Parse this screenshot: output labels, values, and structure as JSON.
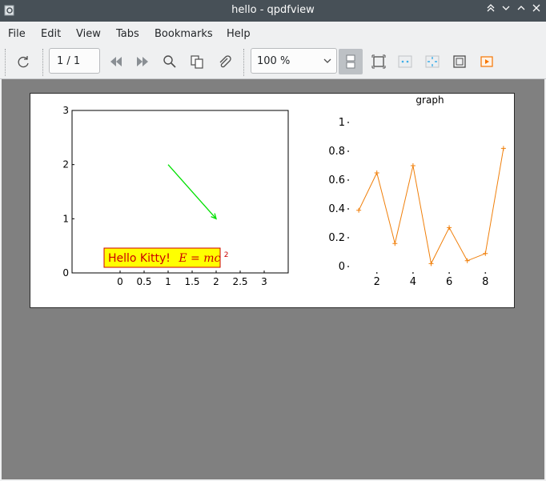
{
  "window": {
    "title": "hello - qpdfview",
    "buttons": [
      "keep-above",
      "minimize",
      "maximize",
      "close"
    ]
  },
  "menu": {
    "items": [
      "File",
      "Edit",
      "View",
      "Tabs",
      "Bookmarks",
      "Help"
    ]
  },
  "toolbar": {
    "page_indicator": "1 / 1",
    "zoom_value": "100 %",
    "icons": [
      "refresh-icon",
      "previous-page-icon",
      "next-page-icon",
      "search-icon",
      "copy-to-clipboard-icon",
      "attachment-icon",
      "continuous-mode-icon",
      "fit-to-page-icon",
      "two-pages-icon",
      "presentation-icon",
      "fullscreen-icon",
      "slideshow-icon"
    ],
    "accent_color": "#f67400"
  },
  "document": {
    "left_plot": {
      "label_text": "Hello Kitty!",
      "label_formula": "E = mc",
      "label_formula_exponent": "2",
      "label_text_color": "#cc0000",
      "label_fill_color": "#ffff00",
      "arrow_color": "#00e000"
    },
    "right_plot": {
      "title": "graph",
      "line_color": "#f07f0a"
    }
  },
  "chart_data": [
    {
      "type": "line",
      "title": "",
      "xlabel": "",
      "ylabel": "",
      "xlim": [
        -1,
        3.5
      ],
      "ylim": [
        0,
        3
      ],
      "x_ticks": [
        "0",
        "0.5",
        "1",
        "1.5",
        "2",
        "2.5",
        "3"
      ],
      "y_ticks": [
        "0",
        "1",
        "2",
        "3"
      ],
      "series": [
        {
          "x": [
            1,
            2
          ],
          "y": [
            2,
            1
          ],
          "style": "arrow"
        }
      ],
      "annotation": {
        "text": "Hello Kitty! E = mc^2",
        "x": 1.25,
        "y": 0.27
      }
    },
    {
      "type": "line",
      "title": "graph",
      "xlabel": "",
      "ylabel": "",
      "xlim": [
        0.95,
        9.05
      ],
      "ylim": [
        -0.1,
        1.05
      ],
      "x_ticks": [
        "2",
        "4",
        "6",
        "8"
      ],
      "y_ticks": [
        "0",
        "0.2",
        "0.4",
        "0.6",
        "0.8",
        "1"
      ],
      "series": [
        {
          "x": [
            1,
            2,
            3,
            4,
            5,
            6,
            7,
            8,
            9
          ],
          "y": [
            0.39,
            0.65,
            0.16,
            0.7,
            0.02,
            0.27,
            0.04,
            0.09,
            0.82
          ]
        }
      ]
    }
  ]
}
